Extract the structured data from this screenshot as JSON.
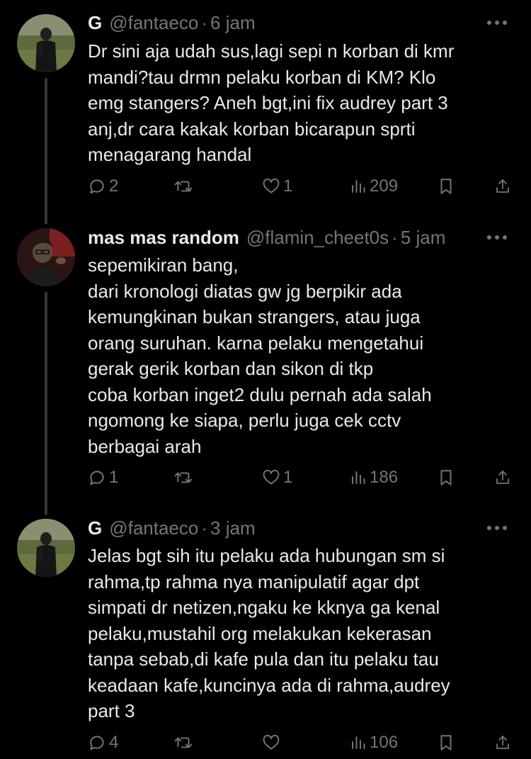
{
  "tweets": [
    {
      "name": "G",
      "handle": "@fantaeco",
      "dot": "·",
      "time": "6 jam",
      "lines": [
        "Dr sini aja udah sus,lagi sepi n korban di kmr",
        "mandi?tau drmn pelaku korban di KM? Klo",
        "emg stangers? Aneh bgt,ini fix audrey part 3",
        "anj,dr cara kakak korban bicarapun sprti",
        "menagarang handal"
      ],
      "replies": "2",
      "reposts": "",
      "likes": "1",
      "views": "209"
    },
    {
      "name": "mas mas random",
      "handle": "@flamin_cheet0s",
      "dot": "·",
      "time": "5 jam",
      "lines": [
        "sepemikiran bang,",
        "dari kronologi diatas gw jg berpikir ada",
        "kemungkinan bukan strangers, atau juga",
        "orang suruhan. karna pelaku mengetahui",
        "gerak gerik korban dan sikon di tkp",
        "coba korban inget2 dulu pernah ada salah",
        "ngomong ke siapa, perlu juga cek cctv",
        "berbagai arah"
      ],
      "replies": "1",
      "reposts": "",
      "likes": "1",
      "views": "186"
    },
    {
      "name": "G",
      "handle": "@fantaeco",
      "dot": "·",
      "time": "3 jam",
      "lines": [
        "Jelas bgt sih itu pelaku ada hubungan sm si",
        "rahma,tp rahma nya manipulatif agar dpt",
        "simpati dr netizen,ngaku ke kknya ga kenal",
        "pelaku,mustahil org melakukan kekerasan",
        "tanpa sebab,di kafe pula dan itu pelaku tau",
        "keadaan kafe,kuncinya ada di rahma,audrey",
        "part 3"
      ],
      "replies": "4",
      "reposts": "",
      "likes": "",
      "views": "106"
    }
  ],
  "icons": {
    "reply": "reply-icon",
    "repost": "repost-icon",
    "like": "like-icon",
    "views": "views-icon",
    "bookmark": "bookmark-icon",
    "share": "share-icon",
    "more": "more-icon"
  },
  "colors": {
    "background": "#000000",
    "text": "#e7e9ea",
    "secondary": "#71767b",
    "thread_line": "#333639"
  }
}
